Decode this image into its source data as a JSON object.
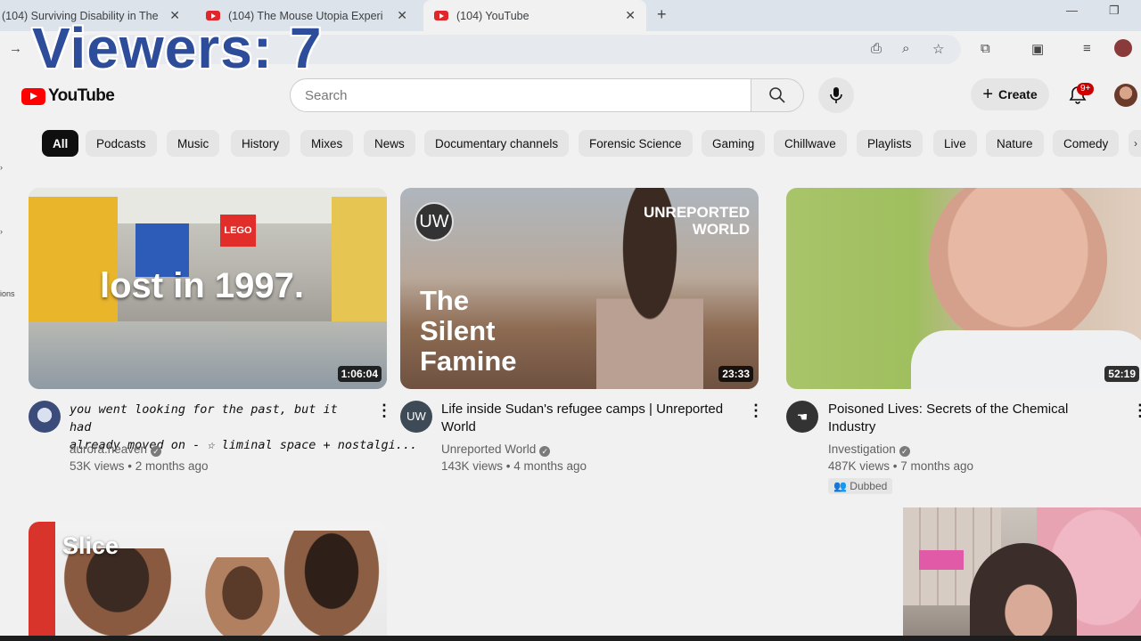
{
  "browser": {
    "tabs": [
      {
        "title": "(104) Surviving Disability in The"
      },
      {
        "title": "(104) The Mouse Utopia Experi"
      },
      {
        "title": "(104) YouTube"
      }
    ],
    "new_tab": "+"
  },
  "overlay": {
    "viewers": "Viewers: 7"
  },
  "header": {
    "logo_text": "YouTube",
    "search_placeholder": "Search",
    "create_label": "Create",
    "notifications_count": "9+"
  },
  "chips": [
    "All",
    "Podcasts",
    "Music",
    "History",
    "Mixes",
    "News",
    "Documentary channels",
    "Forensic Science",
    "Gaming",
    "Chillwave",
    "Playlists",
    "Live",
    "Nature",
    "Comedy"
  ],
  "sidebar_fragments": [
    "ions"
  ],
  "videos": [
    {
      "thumb_text": "lost in 1997.",
      "thumb_sign": "LEGO",
      "duration": "1:06:04",
      "title_line1": "you went looking for the past, but it had",
      "title_line2": "already moved on - ☆ liminal space + nostalgi...",
      "channel": "aurora.heaven",
      "stats": "53K views • 2 months ago"
    },
    {
      "thumb_brand": "UNREPORTED",
      "thumb_brand2": "WORLD",
      "thumb_logo": "UW",
      "thumb_text1": "The",
      "thumb_text2": "Silent",
      "thumb_text3": "Famine",
      "duration": "23:33",
      "title_line1": "Life inside Sudan's refugee camps | Unreported",
      "title_line2": "World",
      "channel_avatar": "UW",
      "channel": "Unreported World",
      "stats": "143K views • 4 months ago"
    },
    {
      "duration": "52:19",
      "title_line1": "Poisoned Lives: Secrets of the Chemical",
      "title_line2": "Industry",
      "channel": "Investigation",
      "stats": "487K views • 7 months ago",
      "badge": "Dubbed"
    },
    {
      "thumb_text": "Slice"
    }
  ]
}
